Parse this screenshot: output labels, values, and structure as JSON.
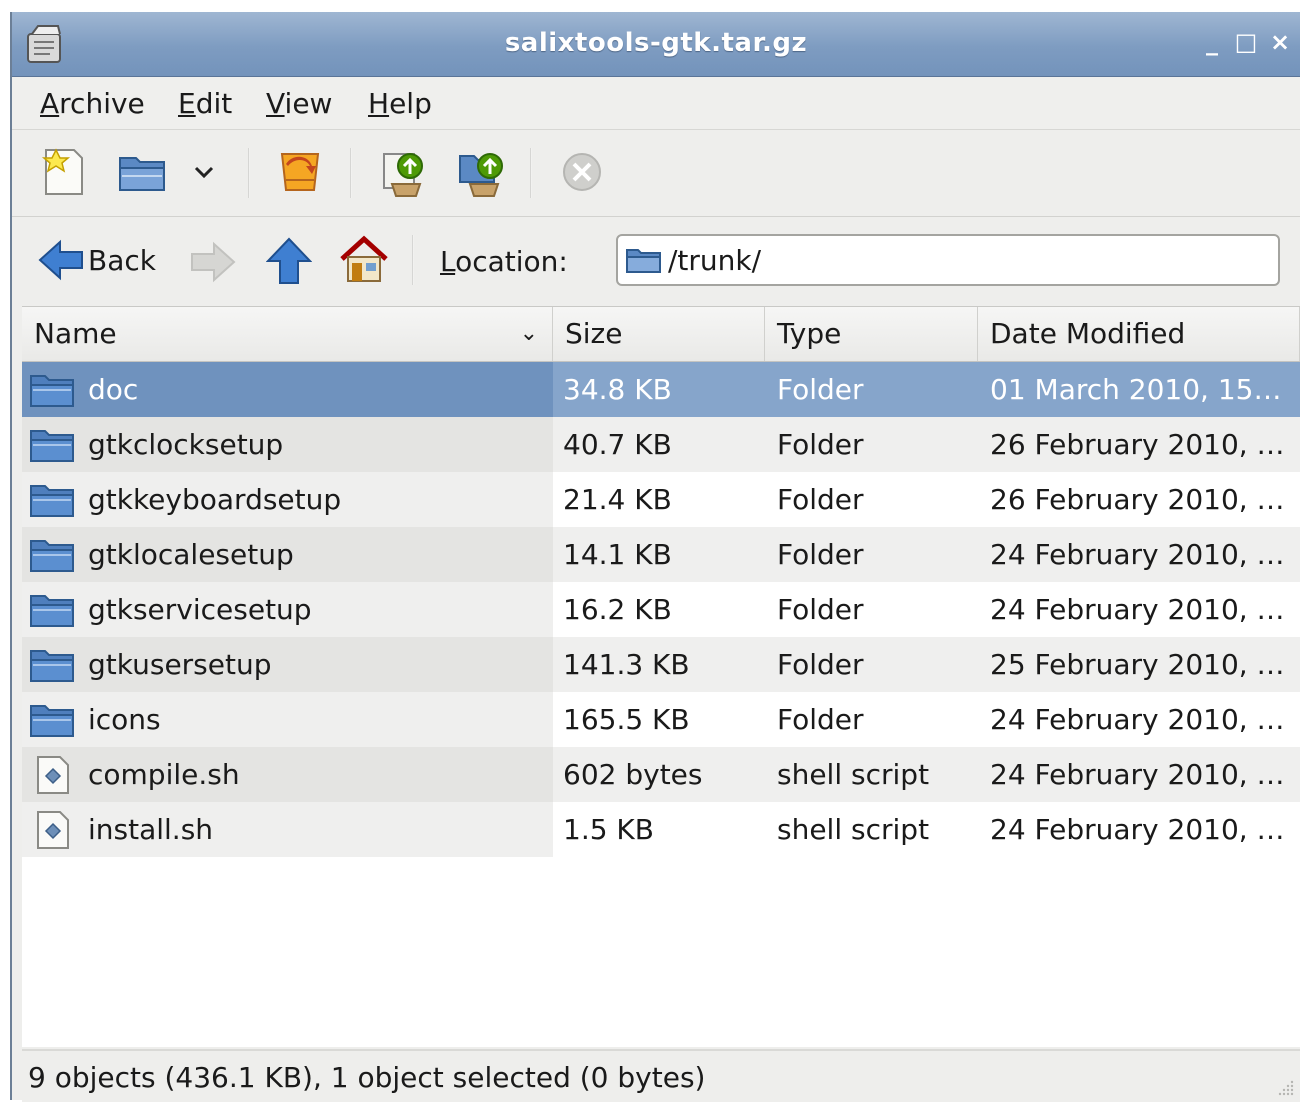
{
  "window": {
    "title": "salixtools-gtk.tar.gz",
    "controls": {
      "minimize": "_",
      "maximize": "□",
      "close": "×"
    }
  },
  "menubar": {
    "items": [
      {
        "mnemonic": "A",
        "rest": "rchive"
      },
      {
        "mnemonic": "E",
        "rest": "dit"
      },
      {
        "mnemonic": "V",
        "rest": "iew"
      },
      {
        "mnemonic": "H",
        "rest": "elp"
      }
    ]
  },
  "toolbar": {
    "icons": [
      "new-archive-icon",
      "open-archive-icon",
      "dropdown-icon",
      "extract-icon",
      "add-files-icon",
      "add-folder-icon",
      "stop-icon"
    ]
  },
  "navigation": {
    "back_label": "Back",
    "location_mnemonic": "L",
    "location_rest": "ocation:",
    "location_value": "/trunk/"
  },
  "columns": {
    "name": "Name",
    "size": "Size",
    "type": "Type",
    "date": "Date Modified"
  },
  "files": [
    {
      "name": "doc",
      "size": "34.8 KB",
      "type": "Folder",
      "date": "01 March 2010, 15…",
      "kind": "folder"
    },
    {
      "name": "gtkclocksetup",
      "size": "40.7 KB",
      "type": "Folder",
      "date": "26 February 2010, …",
      "kind": "folder"
    },
    {
      "name": "gtkkeyboardsetup",
      "size": "21.4 KB",
      "type": "Folder",
      "date": "26 February 2010, …",
      "kind": "folder"
    },
    {
      "name": "gtklocalesetup",
      "size": "14.1 KB",
      "type": "Folder",
      "date": "24 February 2010, …",
      "kind": "folder"
    },
    {
      "name": "gtkservicesetup",
      "size": "16.2 KB",
      "type": "Folder",
      "date": "24 February 2010, …",
      "kind": "folder"
    },
    {
      "name": "gtkusersetup",
      "size": "141.3 KB",
      "type": "Folder",
      "date": "25 February 2010, …",
      "kind": "folder"
    },
    {
      "name": "icons",
      "size": "165.5 KB",
      "type": "Folder",
      "date": "24 February 2010, …",
      "kind": "folder"
    },
    {
      "name": "compile.sh",
      "size": "602 bytes",
      "type": "shell script",
      "date": "24 February 2010, …",
      "kind": "script"
    },
    {
      "name": "install.sh",
      "size": "1.5 KB",
      "type": "shell script",
      "date": "24 February 2010, …",
      "kind": "script"
    }
  ],
  "selected_index": 0,
  "status": "9 objects (436.1 KB), 1 object selected (0 bytes)",
  "colors": {
    "selection": "#86a5cb",
    "selection_name": "#6f92be",
    "titlebar": "#7e9cc1"
  }
}
